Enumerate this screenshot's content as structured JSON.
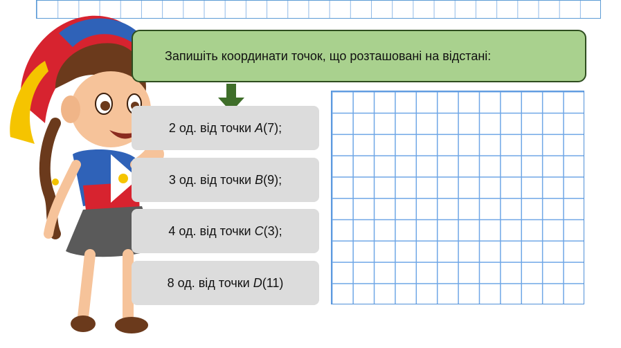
{
  "instruction": "Запишіть координати точок, що розташовані на відстані:",
  "tasks": [
    {
      "prefix": "2 од. від точки ",
      "point": "A",
      "coord": "(7);"
    },
    {
      "prefix": "3 од. від точки ",
      "point": "B",
      "coord": "(9);"
    },
    {
      "prefix": "4 од. від точки ",
      "point": "C",
      "coord": "(3);"
    },
    {
      "prefix": "8 од. від точки ",
      "point": "D",
      "coord": "(11)"
    }
  ],
  "colors": {
    "banner": "#a9d18e",
    "banner_border": "#2e4d1f",
    "arrow": "#3f6e2a",
    "card": "#dcdcdc",
    "grid_lines": "#6ea6e6"
  },
  "icons": {
    "character": "girl-cartoon-illustration",
    "arrow": "down-arrow-icon"
  }
}
